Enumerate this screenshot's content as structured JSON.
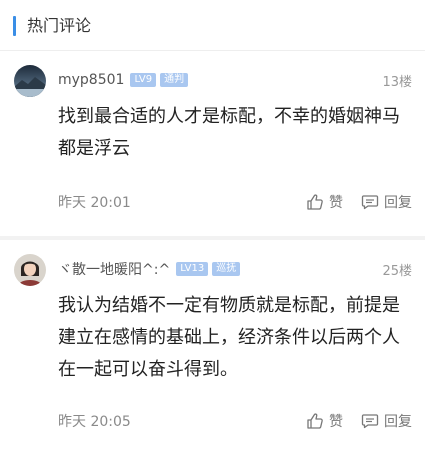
{
  "section": {
    "title": "热门评论"
  },
  "comments": [
    {
      "username": "myp8501",
      "level": "LV9",
      "role": "通判",
      "floor": "13楼",
      "text": "找到最合适的人才是标配，不幸的婚姻神马都是浮云",
      "time": "昨天 20:01",
      "like_label": "赞",
      "reply_label": "回复"
    },
    {
      "username": "ヾ散一地暖阳^:^",
      "level": "LV13",
      "role": "巡抚",
      "floor": "25楼",
      "text": "我认为结婚不一定有物质就是标配，前提是建立在感情的基础上，经济条件以后两个人在一起可以奋斗得到。",
      "time": "昨天 20:05",
      "like_label": "赞",
      "reply_label": "回复"
    }
  ],
  "colors": {
    "accent": "#3a8ee6",
    "badge": "#a9c7f0"
  },
  "icons": [
    "thumbs-up-icon",
    "comment-icon"
  ]
}
